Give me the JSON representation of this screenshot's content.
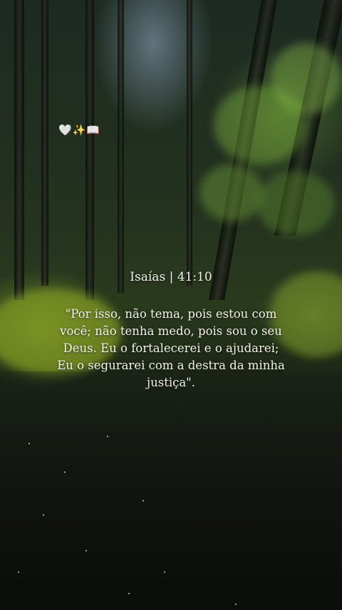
{
  "decoration": {
    "emojis": "🤍✨📖"
  },
  "verse": {
    "reference": "Isaías | 41:10",
    "text": "\"Por isso, não tema, pois estou com você; não tenha medo, pois sou o seu Deus. Eu o fortalecerei e o ajudarei; Eu o segurarei com a destra da minha justiça\"."
  },
  "background": {
    "scene": "forest-stream",
    "colors": {
      "moss": "#7c8f24",
      "leaf": "#8fbf3a",
      "shadow": "#0c110c"
    }
  }
}
